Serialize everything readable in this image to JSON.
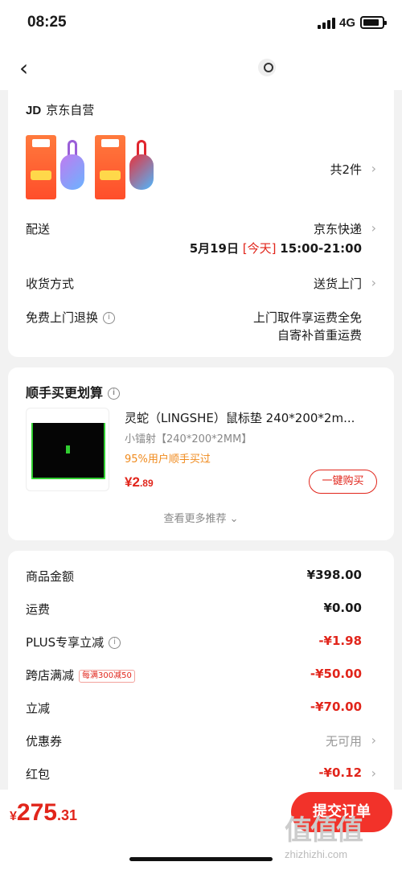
{
  "status_bar": {
    "time": "08:25",
    "network": "4G"
  },
  "store": {
    "brand": "JD",
    "name": "京东自营"
  },
  "items": {
    "count_text": "共2件"
  },
  "delivery": {
    "label": "配送",
    "carrier": "京东快递",
    "date": "5月19日",
    "today": "[今天]",
    "window": "15:00-21:00"
  },
  "receive": {
    "label": "收货方式",
    "value": "送货上门"
  },
  "returns": {
    "label": "免费上门退换",
    "line1": "上门取件享运费全免",
    "line2": "自寄补首重运费"
  },
  "recommend": {
    "title": "顺手买更划算",
    "product_name": "灵蛇（LINGSHE）鼠标垫 240*200*2m...",
    "spec": "小镭射【240*200*2MM】",
    "tag": "95%用户顺手买过",
    "price_currency": "¥",
    "price_int": "2",
    "price_dec": ".89",
    "buy_label": "一键购买",
    "more_label": "查看更多推荐 ⌄"
  },
  "summary": {
    "goods_label": "商品金额",
    "goods_value": "¥398.00",
    "shipping_label": "运费",
    "shipping_value": "¥0.00",
    "plus_label": "PLUS专享立减",
    "plus_value": "-¥1.98",
    "cross_label": "跨店满减",
    "cross_badge": "每满300减50",
    "cross_value": "-¥50.00",
    "instant_label": "立减",
    "instant_value": "-¥70.00",
    "coupon_label": "优惠券",
    "coupon_value": "无可用",
    "redpacket_label": "红包",
    "redpacket_value": "-¥0.12"
  },
  "footer": {
    "currency": "¥",
    "total_int": "275",
    "total_dec": ".31",
    "submit_label": "提交订单"
  },
  "watermark": {
    "logo": "值值值",
    "url": "zhizhizhi.com"
  },
  "colors": {
    "accent": "#e1251b",
    "orange": "#f08a1c"
  },
  "icons": [
    "back-icon",
    "location-icon",
    "info-icon",
    "chevron-right-icon",
    "chevron-down-icon"
  ]
}
